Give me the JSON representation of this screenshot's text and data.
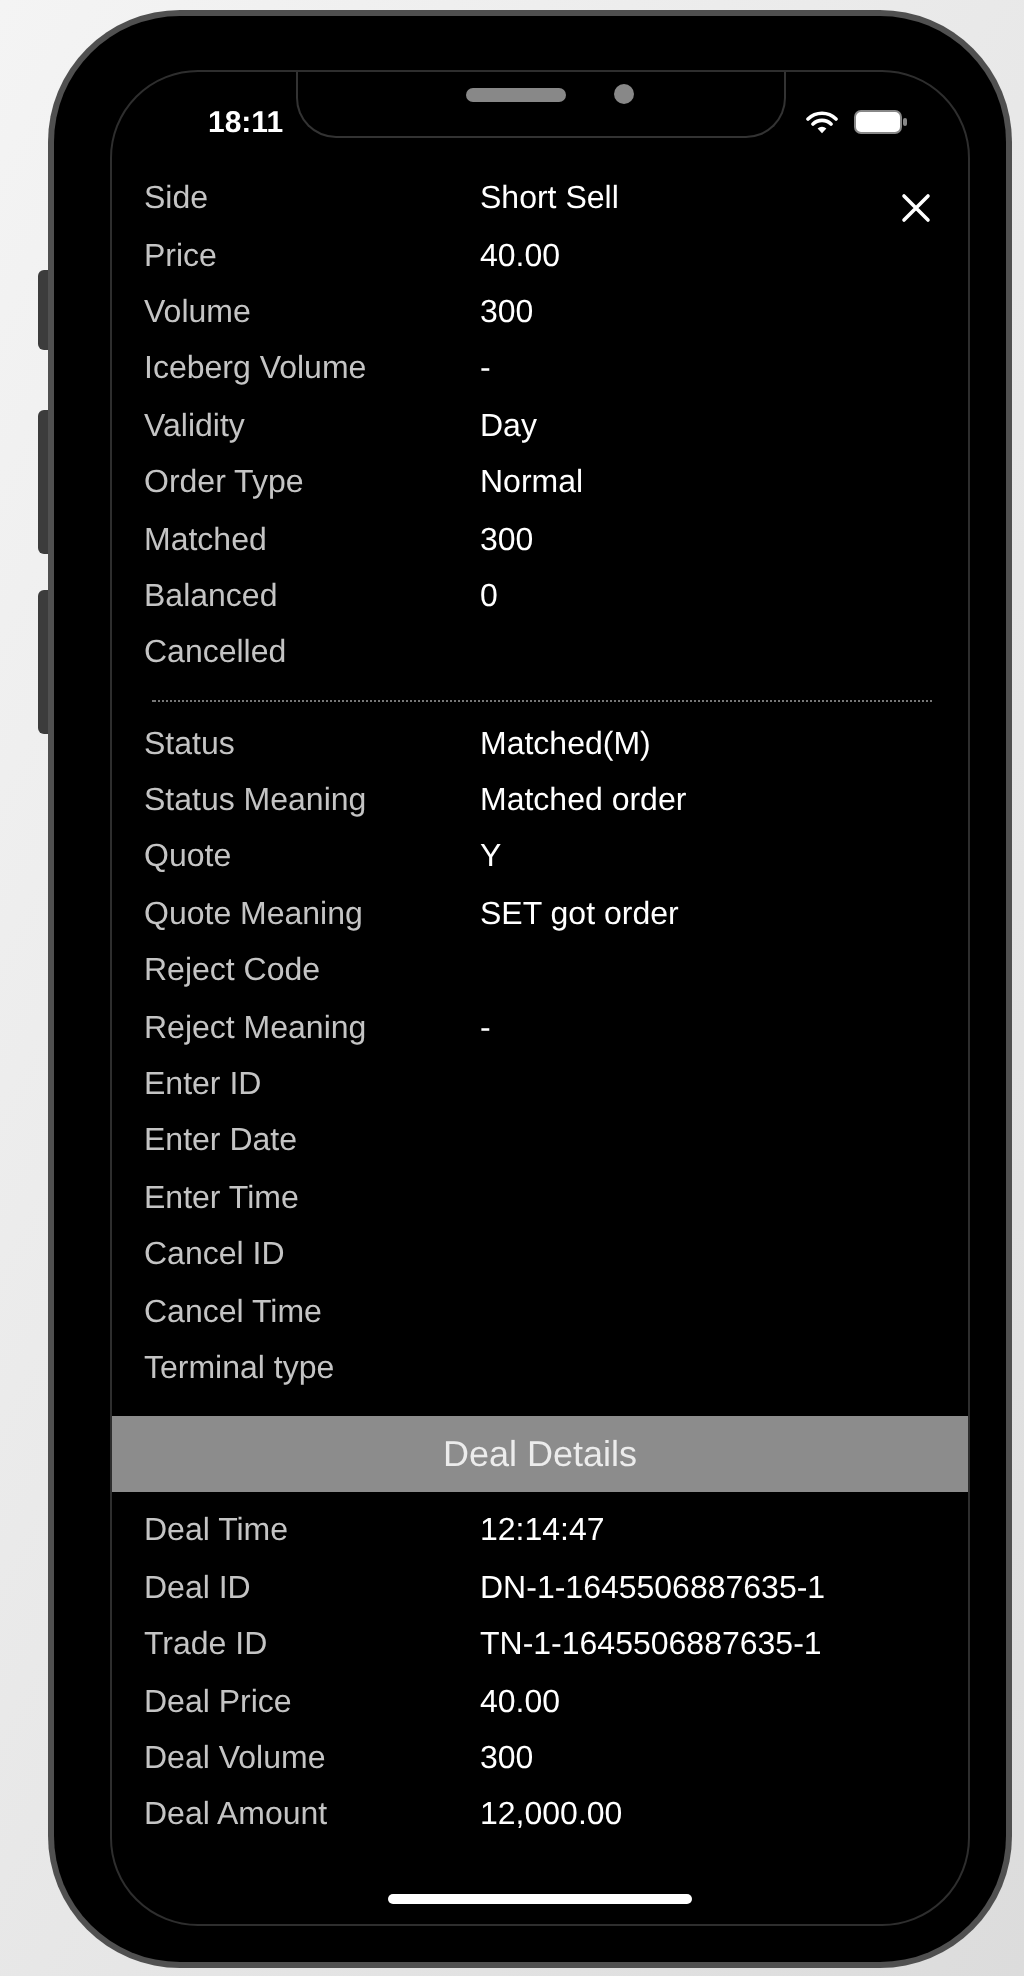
{
  "status_bar": {
    "time": "18:11"
  },
  "order_fields": [
    {
      "label": "Side",
      "value": "Short Sell"
    },
    {
      "label": "Price",
      "value": "40.00"
    },
    {
      "label": "Volume",
      "value": "300"
    },
    {
      "label": "Iceberg Volume",
      "value": "-"
    },
    {
      "label": "Validity",
      "value": "Day"
    },
    {
      "label": "Order Type",
      "value": "Normal"
    },
    {
      "label": "Matched",
      "value": "300"
    },
    {
      "label": "Balanced",
      "value": "0"
    },
    {
      "label": "Cancelled"
    }
  ],
  "status_fields": [
    {
      "label": "Status",
      "value": "Matched(M)"
    },
    {
      "label": "Status Meaning",
      "value": "Matched order"
    },
    {
      "label": "Quote",
      "value": "Y"
    },
    {
      "label": "Quote Meaning",
      "value": "SET got order"
    },
    {
      "label": "Reject Code"
    },
    {
      "label": "Reject Meaning",
      "value": "-"
    },
    {
      "label": "Enter ID"
    },
    {
      "label": "Enter Date"
    },
    {
      "label": "Enter Time"
    },
    {
      "label": "Cancel ID"
    },
    {
      "label": "Cancel Time"
    },
    {
      "label": "Terminal type"
    }
  ],
  "deal_details": {
    "title": "Deal Details",
    "rows": [
      {
        "label": "Deal Time",
        "value": "12:14:47"
      },
      {
        "label": "Deal ID",
        "value": "DN-1-1645506887635-1"
      },
      {
        "label": "Trade ID",
        "value": "TN-1-1645506887635-1"
      },
      {
        "label": "Deal Price",
        "value": "40.00"
      },
      {
        "label": "Deal Volume",
        "value": "300"
      },
      {
        "label": "Deal Amount",
        "value": "12,000.00"
      }
    ]
  }
}
